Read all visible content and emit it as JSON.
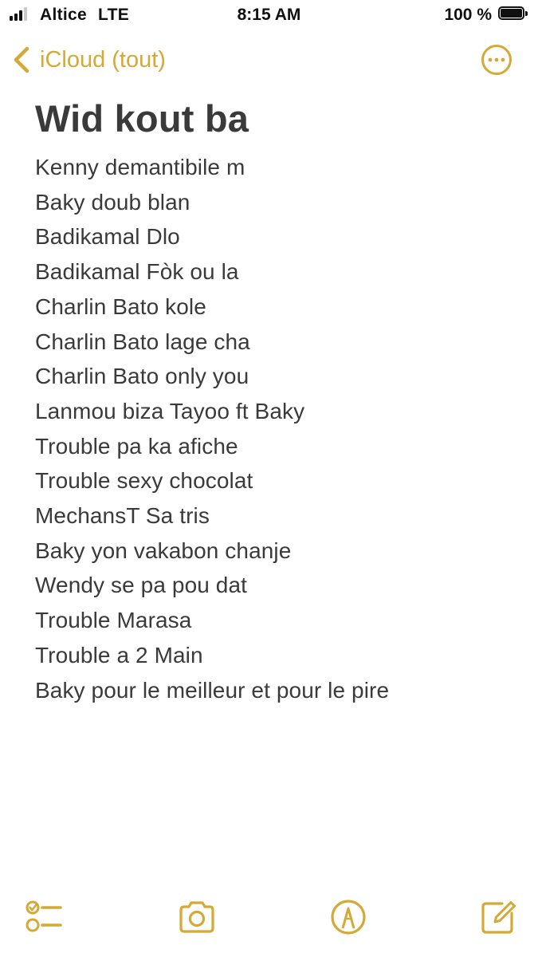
{
  "status_bar": {
    "carrier": "Altice",
    "network": "LTE",
    "time": "8:15 AM",
    "battery": "100 %"
  },
  "nav": {
    "back_label": "iCloud (tout)"
  },
  "note": {
    "title": "Wid kout ba",
    "lines": [
      "Kenny demantibile m",
      "Baky doub blan",
      "Badikamal Dlo",
      "Badikamal Fòk ou la",
      "Charlin Bato kole",
      "Charlin Bato lage cha",
      "Charlin Bato only you",
      "Lanmou biza Tayoo ft Baky",
      "Trouble pa ka afiche",
      "Trouble sexy chocolat",
      "MechansT Sa tris",
      "Baky yon vakabon chanje",
      "Wendy se pa pou dat",
      "Trouble Marasa",
      "Trouble a 2 Main",
      "Baky pour le meilleur et pour le pire"
    ]
  },
  "toolbar": {
    "icons": [
      "checklist-icon",
      "camera-icon",
      "markup-icon",
      "compose-icon"
    ]
  },
  "colors": {
    "accent": "#d4a935",
    "text": "#3a3a3a"
  }
}
